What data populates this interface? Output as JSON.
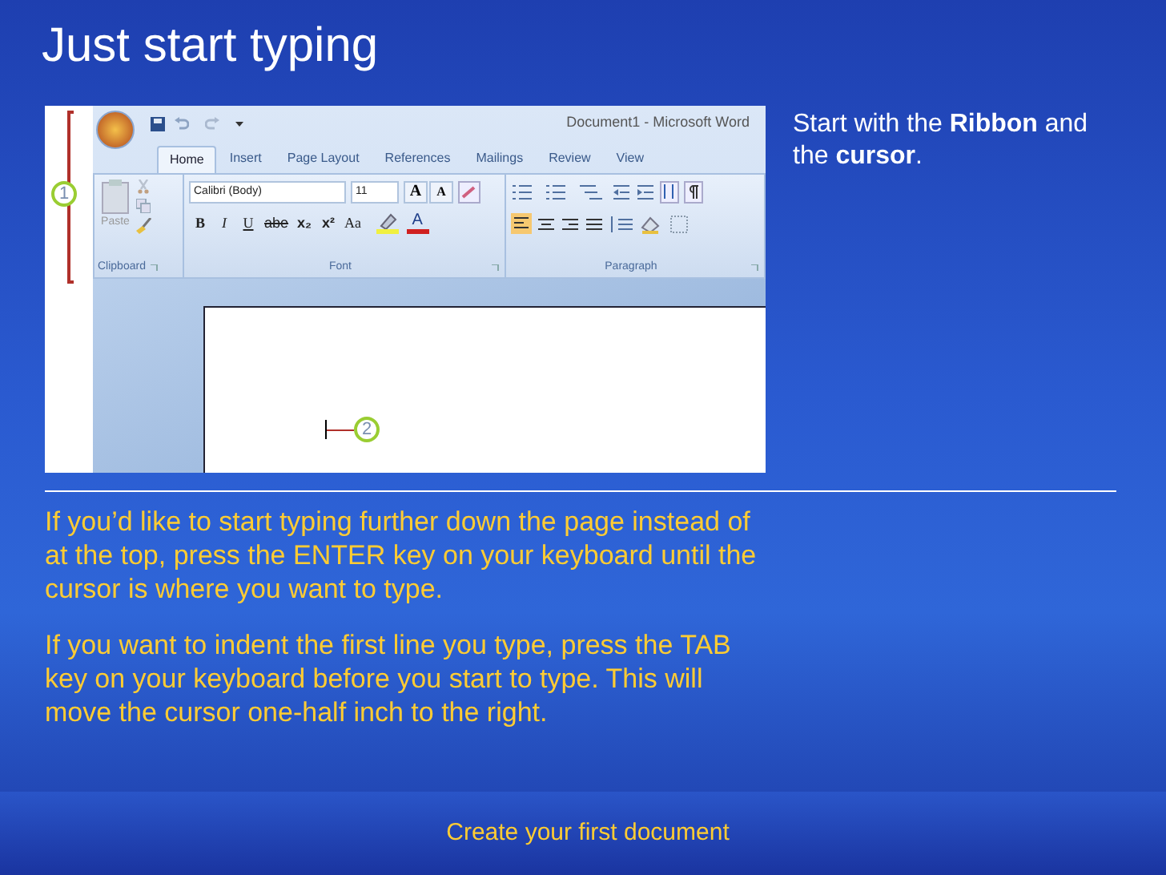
{
  "slide_title": "Just start typing",
  "screenshot": {
    "window_title": "Document1 - Microsoft Word",
    "tabs": [
      {
        "label": "Home",
        "selected": true
      },
      {
        "label": "Insert",
        "selected": false
      },
      {
        "label": "Page Layout",
        "selected": false
      },
      {
        "label": "References",
        "selected": false
      },
      {
        "label": "Mailings",
        "selected": false
      },
      {
        "label": "Review",
        "selected": false
      },
      {
        "label": "View",
        "selected": false
      }
    ],
    "paste_label": "Paste",
    "font_name": "Calibri (Body)",
    "font_size": "11",
    "size_buttons": [
      "A",
      "A"
    ],
    "format_buttons": [
      "B",
      "I",
      "U",
      "abe",
      "x₂",
      "x²",
      "Aa"
    ],
    "font_color_button": "A",
    "groups": [
      "Clipboard",
      "Font",
      "Paragraph"
    ],
    "callouts": [
      "1",
      "2"
    ]
  },
  "caption": "Start with the **Ribbon** and the **cursor**.",
  "paragraphs": [
    "If you’d like to start typing further down the page instead of at the top, press the ENTER key on your keyboard until the cursor is where you want to type.",
    "If you want to indent the first line you type, press the TAB key on your keyboard before you start to type. This will move the cursor one-half inch to the right."
  ],
  "footer": "Create your first document"
}
